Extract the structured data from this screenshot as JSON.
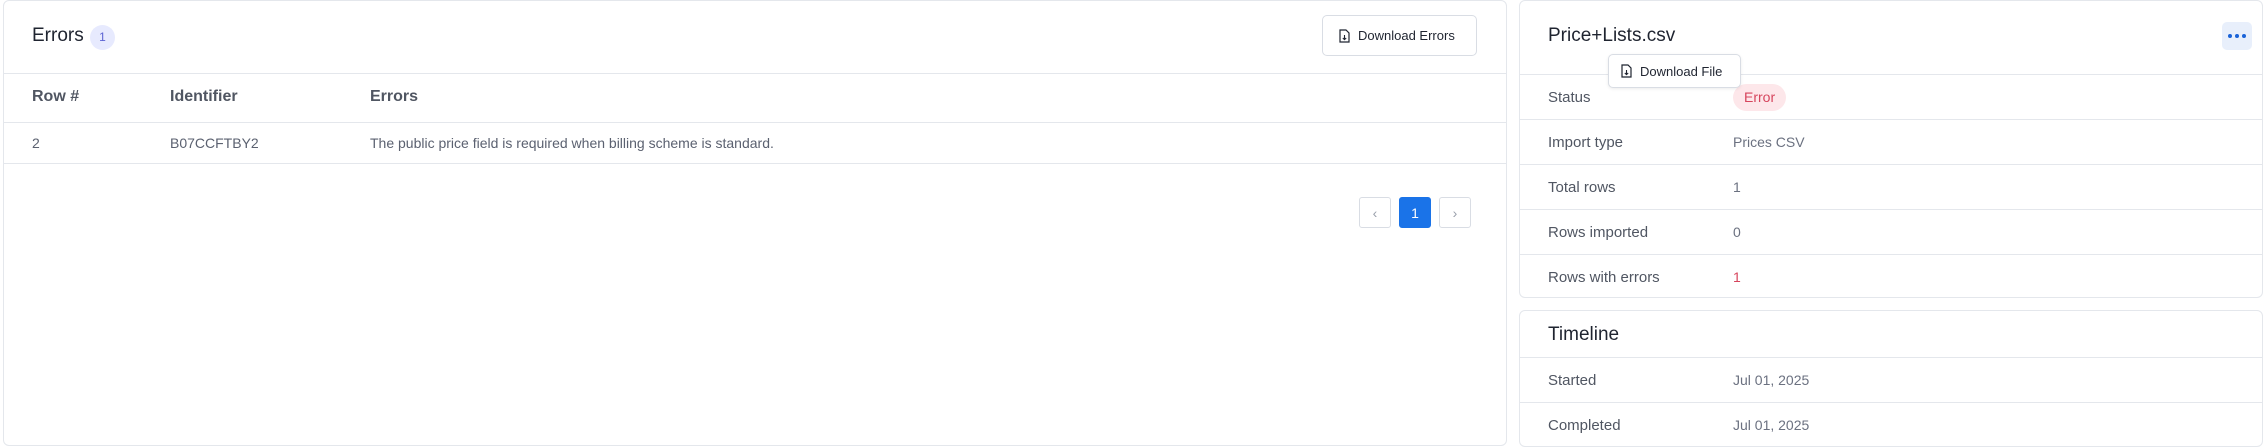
{
  "errors": {
    "title": "Errors",
    "count": "1",
    "download_label": "Download Errors",
    "columns": [
      "Row #",
      "Identifier",
      "Errors"
    ],
    "rows": [
      {
        "row": "2",
        "identifier": "B07CCFTBY2",
        "error": "The public price field is required when billing scheme is standard."
      }
    ],
    "pagination": {
      "prev": "‹",
      "current": "1",
      "next": "›"
    }
  },
  "file": {
    "name": "Price+Lists.csv",
    "download_label": "Download File",
    "details": [
      {
        "key": "Status",
        "value": "Error"
      },
      {
        "key": "Import type",
        "value": "Prices CSV"
      },
      {
        "key": "Total rows",
        "value": "1"
      },
      {
        "key": "Rows imported",
        "value": "0"
      },
      {
        "key": "Rows with errors",
        "value": "1"
      }
    ]
  },
  "timeline": {
    "title": "Timeline",
    "items": [
      {
        "key": "Started",
        "value": "Jul 01, 2025"
      },
      {
        "key": "Completed",
        "value": "Jul 01, 2025"
      }
    ]
  },
  "colors": {
    "accent": "#1a73e8",
    "error": "#d6455d",
    "badge_bg": "#e7eafe"
  }
}
